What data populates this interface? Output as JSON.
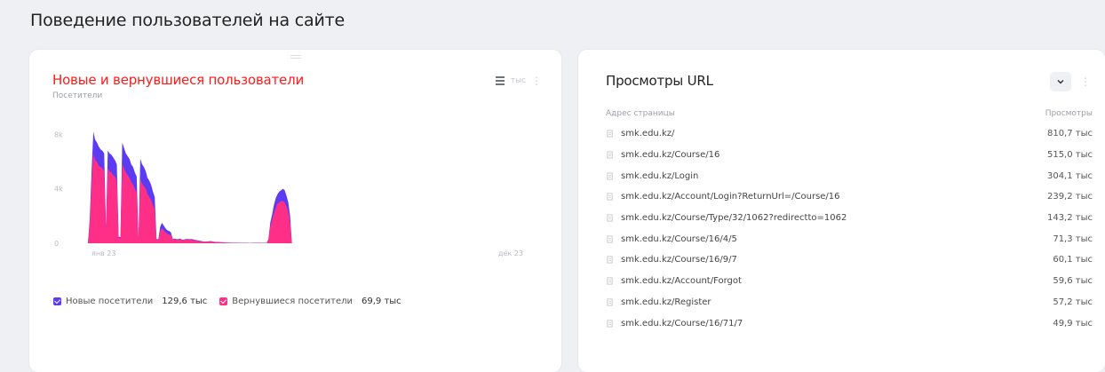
{
  "page": {
    "title": "Поведение пользователей на сайте"
  },
  "left_card": {
    "title": "Новые и вернувшиеся пользователи",
    "subtitle": "Посетители",
    "toolbar_label": "тыс",
    "y_ticks": [
      "8k",
      "4k",
      "0"
    ],
    "x_ticks": [
      "янв 23",
      "дек 23"
    ],
    "legend": [
      {
        "label": "Новые посетители",
        "value": "129,6 тыс",
        "color": "#5b3cf2"
      },
      {
        "label": "Вернувшиеся посетители",
        "value": "69,9 тыс",
        "color": "#ff2e86"
      }
    ]
  },
  "right_card": {
    "title": "Просмотры URL",
    "columns": {
      "url": "Адрес страницы",
      "views": "Просмотры"
    },
    "rows": [
      {
        "url": "smk.edu.kz/",
        "views": "810,7 тыс"
      },
      {
        "url": "smk.edu.kz/Course/16",
        "views": "515,0 тыс"
      },
      {
        "url": "smk.edu.kz/Login",
        "views": "304,1 тыс"
      },
      {
        "url": "smk.edu.kz/Account/Login?ReturnUrl=/Course/16",
        "views": "239,2 тыс"
      },
      {
        "url": "smk.edu.kz/Course/Type/32/1062?redirectto=1062",
        "views": "143,2 тыс"
      },
      {
        "url": "smk.edu.kz/Course/16/4/5",
        "views": "71,3 тыс"
      },
      {
        "url": "smk.edu.kz/Course/16/9/7",
        "views": "60,1 тыс"
      },
      {
        "url": "smk.edu.kz/Account/Forgot",
        "views": "59,6 тыс"
      },
      {
        "url": "smk.edu.kz/Register",
        "views": "57,2 тыс"
      },
      {
        "url": "smk.edu.kz/Course/16/71/7",
        "views": "49,9 тыс"
      }
    ]
  },
  "chart_data": {
    "type": "area",
    "x": [
      0,
      1,
      2,
      3,
      4,
      5,
      6,
      7,
      8,
      9,
      10,
      11,
      12,
      13,
      14,
      15,
      16,
      17,
      18,
      19,
      20,
      21,
      22,
      23,
      24,
      25,
      26,
      27,
      28,
      29,
      30,
      31,
      32,
      33,
      34,
      35,
      36,
      37,
      38,
      39,
      40,
      41,
      42,
      43,
      44,
      45,
      46,
      47,
      48,
      49,
      50,
      51,
      52,
      53,
      54,
      55,
      56,
      57,
      58,
      59,
      60,
      61,
      62,
      63,
      64,
      65,
      66,
      67,
      68,
      69,
      70,
      71,
      72,
      73,
      74,
      75,
      76,
      77,
      78,
      79,
      80,
      81,
      82,
      83,
      84,
      85,
      86,
      87,
      88,
      89,
      90,
      91,
      92,
      93,
      94,
      95,
      96,
      97,
      98,
      99,
      100,
      101,
      102,
      103,
      104,
      105,
      106,
      107,
      108,
      109,
      110,
      111,
      112,
      113,
      114,
      115,
      116,
      117,
      118,
      119,
      120,
      121,
      122,
      123,
      124,
      125,
      126,
      127,
      128,
      129,
      130,
      131,
      132,
      133,
      134,
      135,
      136,
      137,
      138,
      139,
      140,
      141,
      142,
      143,
      144,
      145,
      146,
      147,
      148,
      149,
      150,
      151,
      152,
      153,
      154,
      155,
      156,
      157,
      158,
      159,
      160,
      161,
      162,
      163,
      164,
      165,
      166,
      167,
      168,
      169,
      170,
      171,
      172,
      173,
      174,
      175,
      176,
      177,
      178,
      179,
      180,
      181,
      182,
      183,
      184,
      185,
      186,
      187,
      188,
      189,
      190,
      191,
      192,
      193,
      194,
      195,
      196,
      197,
      198,
      199,
      200,
      201,
      202,
      203,
      204,
      205,
      206,
      207,
      208,
      209,
      210,
      211,
      212,
      213,
      214,
      215,
      216,
      217,
      218,
      219,
      220,
      221,
      222,
      223,
      224,
      225,
      226,
      227,
      228,
      229,
      230,
      231,
      232,
      233,
      234,
      235,
      236,
      237,
      238,
      239,
      240,
      241,
      242,
      243,
      244,
      245,
      246,
      247,
      248,
      249
    ],
    "xticks": [
      "янв 23",
      "дек 23"
    ],
    "yticks": [
      "0",
      "4k",
      "8k"
    ],
    "ylim": [
      0,
      9000
    ],
    "series": [
      {
        "name": "Новые посетители",
        "color": "#5b3cf2",
        "values": [
          0,
          1800,
          5200,
          8200,
          7600,
          7400,
          7100,
          6900,
          6800,
          6600,
          1200,
          6800,
          6600,
          6500,
          6300,
          6100,
          5800,
          500,
          450,
          7400,
          7000,
          6600,
          6400,
          6200,
          5800,
          5600,
          5200,
          4900,
          300,
          6200,
          5800,
          5600,
          5300,
          4800,
          4600,
          4300,
          3800,
          3400,
          300,
          300,
          1200,
          1500,
          1300,
          1100,
          950,
          900,
          800,
          300,
          350,
          300,
          300,
          350,
          280,
          260,
          300,
          320,
          300,
          310,
          290,
          260,
          240,
          200,
          180,
          160,
          120,
          120,
          140,
          140,
          160,
          120,
          110,
          100,
          100,
          90,
          80,
          70,
          60,
          50,
          50,
          40,
          40,
          40,
          40,
          30,
          30,
          30,
          30,
          30,
          30,
          20,
          20,
          30,
          30,
          30,
          40,
          30,
          30,
          30,
          30,
          20,
          300,
          1500,
          2100,
          2800,
          3300,
          3600,
          3800,
          3900,
          4000,
          3900,
          3500,
          3000,
          2000,
          0,
          0,
          0,
          0,
          0,
          0,
          0,
          0,
          0,
          0,
          0,
          0,
          0,
          0,
          0,
          0,
          0,
          0,
          0,
          0,
          0,
          0,
          0,
          0,
          0,
          0,
          0,
          0,
          0,
          0,
          0,
          0,
          0,
          0,
          0,
          0,
          0,
          0,
          0,
          0,
          0,
          0,
          0,
          0,
          0,
          0,
          0,
          0,
          0,
          0,
          0,
          0,
          0,
          0,
          0,
          0,
          0,
          0,
          0,
          0,
          0,
          0,
          0,
          0,
          0,
          0,
          0,
          0,
          0,
          0,
          0,
          0,
          0,
          0,
          0,
          0,
          0,
          0,
          0,
          0,
          0,
          0,
          0,
          0,
          0,
          0,
          0,
          0,
          0,
          0,
          0,
          0,
          0,
          0,
          0,
          0,
          0,
          0,
          0,
          0,
          0,
          0,
          0,
          0,
          0,
          0,
          0,
          0,
          0,
          0,
          0,
          0,
          0,
          0,
          0,
          0,
          0,
          0,
          0,
          0,
          0,
          0,
          0,
          0,
          0,
          0,
          0,
          0,
          0,
          0,
          0,
          0
        ]
      },
      {
        "name": "Вернувшиеся посетители",
        "color": "#ff2e86",
        "values": [
          0,
          1500,
          4300,
          6600,
          6100,
          6000,
          5700,
          5600,
          5500,
          5300,
          1000,
          5500,
          5300,
          5200,
          5000,
          4900,
          4600,
          400,
          350,
          5800,
          5500,
          5200,
          5000,
          4800,
          4500,
          4300,
          4000,
          3700,
          250,
          4700,
          4400,
          4200,
          4000,
          3600,
          3400,
          3200,
          2800,
          2500,
          250,
          250,
          900,
          1100,
          950,
          800,
          700,
          650,
          600,
          250,
          300,
          250,
          250,
          300,
          240,
          220,
          260,
          270,
          260,
          260,
          240,
          220,
          200,
          170,
          150,
          130,
          100,
          100,
          120,
          120,
          130,
          100,
          90,
          80,
          80,
          70,
          60,
          50,
          40,
          40,
          40,
          30,
          30,
          30,
          30,
          20,
          20,
          20,
          20,
          20,
          20,
          10,
          10,
          20,
          20,
          20,
          30,
          20,
          20,
          20,
          20,
          10,
          250,
          1200,
          1700,
          2200,
          2600,
          2900,
          3000,
          3100,
          3100,
          3000,
          2700,
          2300,
          1500,
          0,
          0,
          0,
          0,
          0,
          0,
          0,
          0,
          0,
          0,
          0,
          0,
          0,
          0,
          0,
          0,
          0,
          0,
          0,
          0,
          0,
          0,
          0,
          0,
          0,
          0,
          0,
          0,
          0,
          0,
          0,
          0,
          0,
          0,
          0,
          0,
          0,
          0,
          0,
          0,
          0,
          0,
          0,
          0,
          0,
          0,
          0,
          0,
          0,
          0,
          0,
          0,
          0,
          0,
          0,
          0,
          0,
          0,
          0,
          0,
          0,
          0,
          0,
          0,
          0,
          0,
          0,
          0,
          0,
          0,
          0,
          0,
          0,
          0,
          0,
          0,
          0,
          0,
          0,
          0,
          0,
          0,
          0,
          0,
          0,
          0,
          0,
          0,
          0,
          0,
          0,
          0,
          0,
          0,
          0,
          0,
          0,
          0,
          0,
          0,
          0,
          0,
          0,
          0,
          0,
          0,
          0,
          0,
          0,
          0,
          0,
          0,
          0,
          0,
          0,
          0,
          0,
          0,
          0,
          0,
          0,
          0,
          0,
          0,
          0,
          0,
          0,
          0,
          0,
          0,
          0,
          0
        ]
      }
    ],
    "grid": false,
    "legend_position": "bottom-left"
  }
}
